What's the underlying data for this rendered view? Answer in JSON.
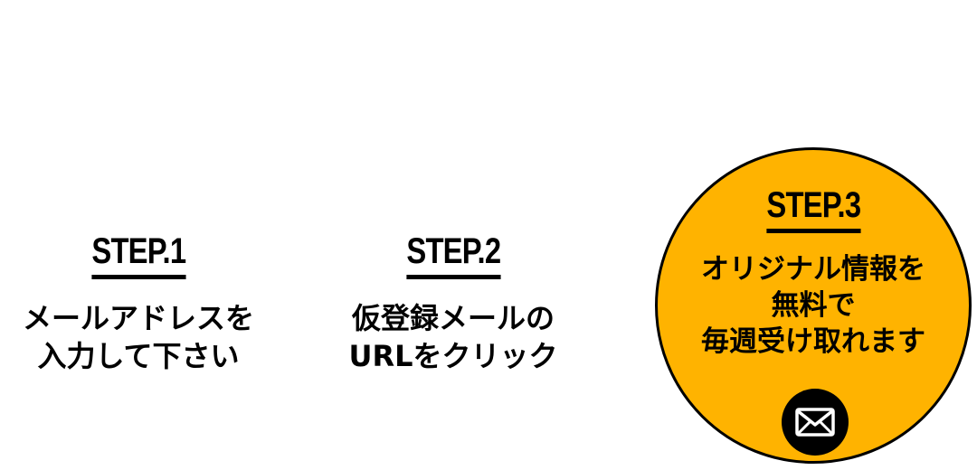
{
  "steps": [
    {
      "title": "STEP.1",
      "text_line1": "メールアドレスを",
      "text_line2": "入力して下さい"
    },
    {
      "title": "STEP.2",
      "text_line1": "仮登録メールの",
      "text_line2": "URLをクリック"
    },
    {
      "title": "STEP.3",
      "text_line1": "オリジナル情報を",
      "text_line2": "無料で",
      "text_line3": "毎週受け取れます",
      "icon": "envelope-icon"
    }
  ],
  "colors": {
    "accent": "#ffb300",
    "text": "#000000",
    "background": "#ffffff"
  }
}
